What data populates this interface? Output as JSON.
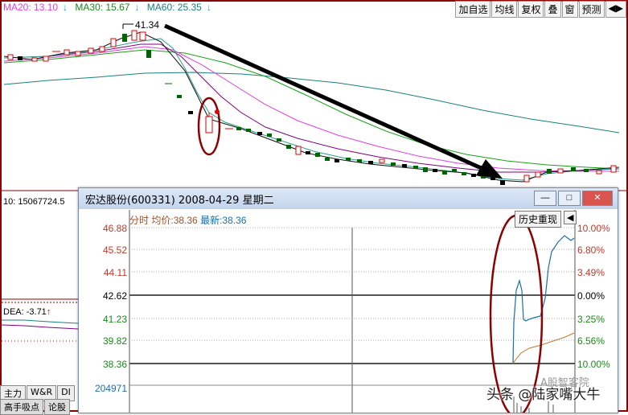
{
  "main": {
    "ma20_label": "MA20: 13.10",
    "ma30_label": "MA30: 15.67",
    "ma60_label": "MA60: 25.35",
    "peak_price": "41.34",
    "vol_label": "10: 15067724.5",
    "dea_label": "DEA: -3.71",
    "colors": {
      "ma20": "#e040e0",
      "ma30": "#1aa01a",
      "ma60": "#1a7f7f",
      "up": "#e00000",
      "down": "#000000",
      "green": "#006400"
    }
  },
  "toolbar": {
    "items": [
      "加自选",
      "均线",
      "复权",
      "叠",
      "窗",
      "预测",
      "◀▶"
    ]
  },
  "bottom_tabs": {
    "row1": [
      "主力",
      "W&R",
      "DI"
    ],
    "row2": [
      "高手吸点",
      "论股"
    ]
  },
  "popup": {
    "title": "宏达股份(600331) 2008-04-29 星期二",
    "info": {
      "mode": "分时",
      "avg_label": "均价:",
      "avg_value": "38.36",
      "latest_label": "最新:",
      "latest_value": "38.36"
    },
    "hist_button": "历史重现",
    "hist_arrow": "◀",
    "win_buttons": [
      "—",
      "□",
      "✕"
    ],
    "left_axis": [
      "46.88",
      "45.52",
      "44.11",
      "42.62",
      "41.23",
      "39.82",
      "38.36",
      "204971"
    ],
    "right_axis": [
      "10.00%",
      "6.80%",
      "3.49%",
      "0.00%",
      "3.25%",
      "6.56%",
      "10.00%"
    ]
  },
  "watermark": "头条 @陆家嘴大牛",
  "watermark2": "A股智客院"
}
